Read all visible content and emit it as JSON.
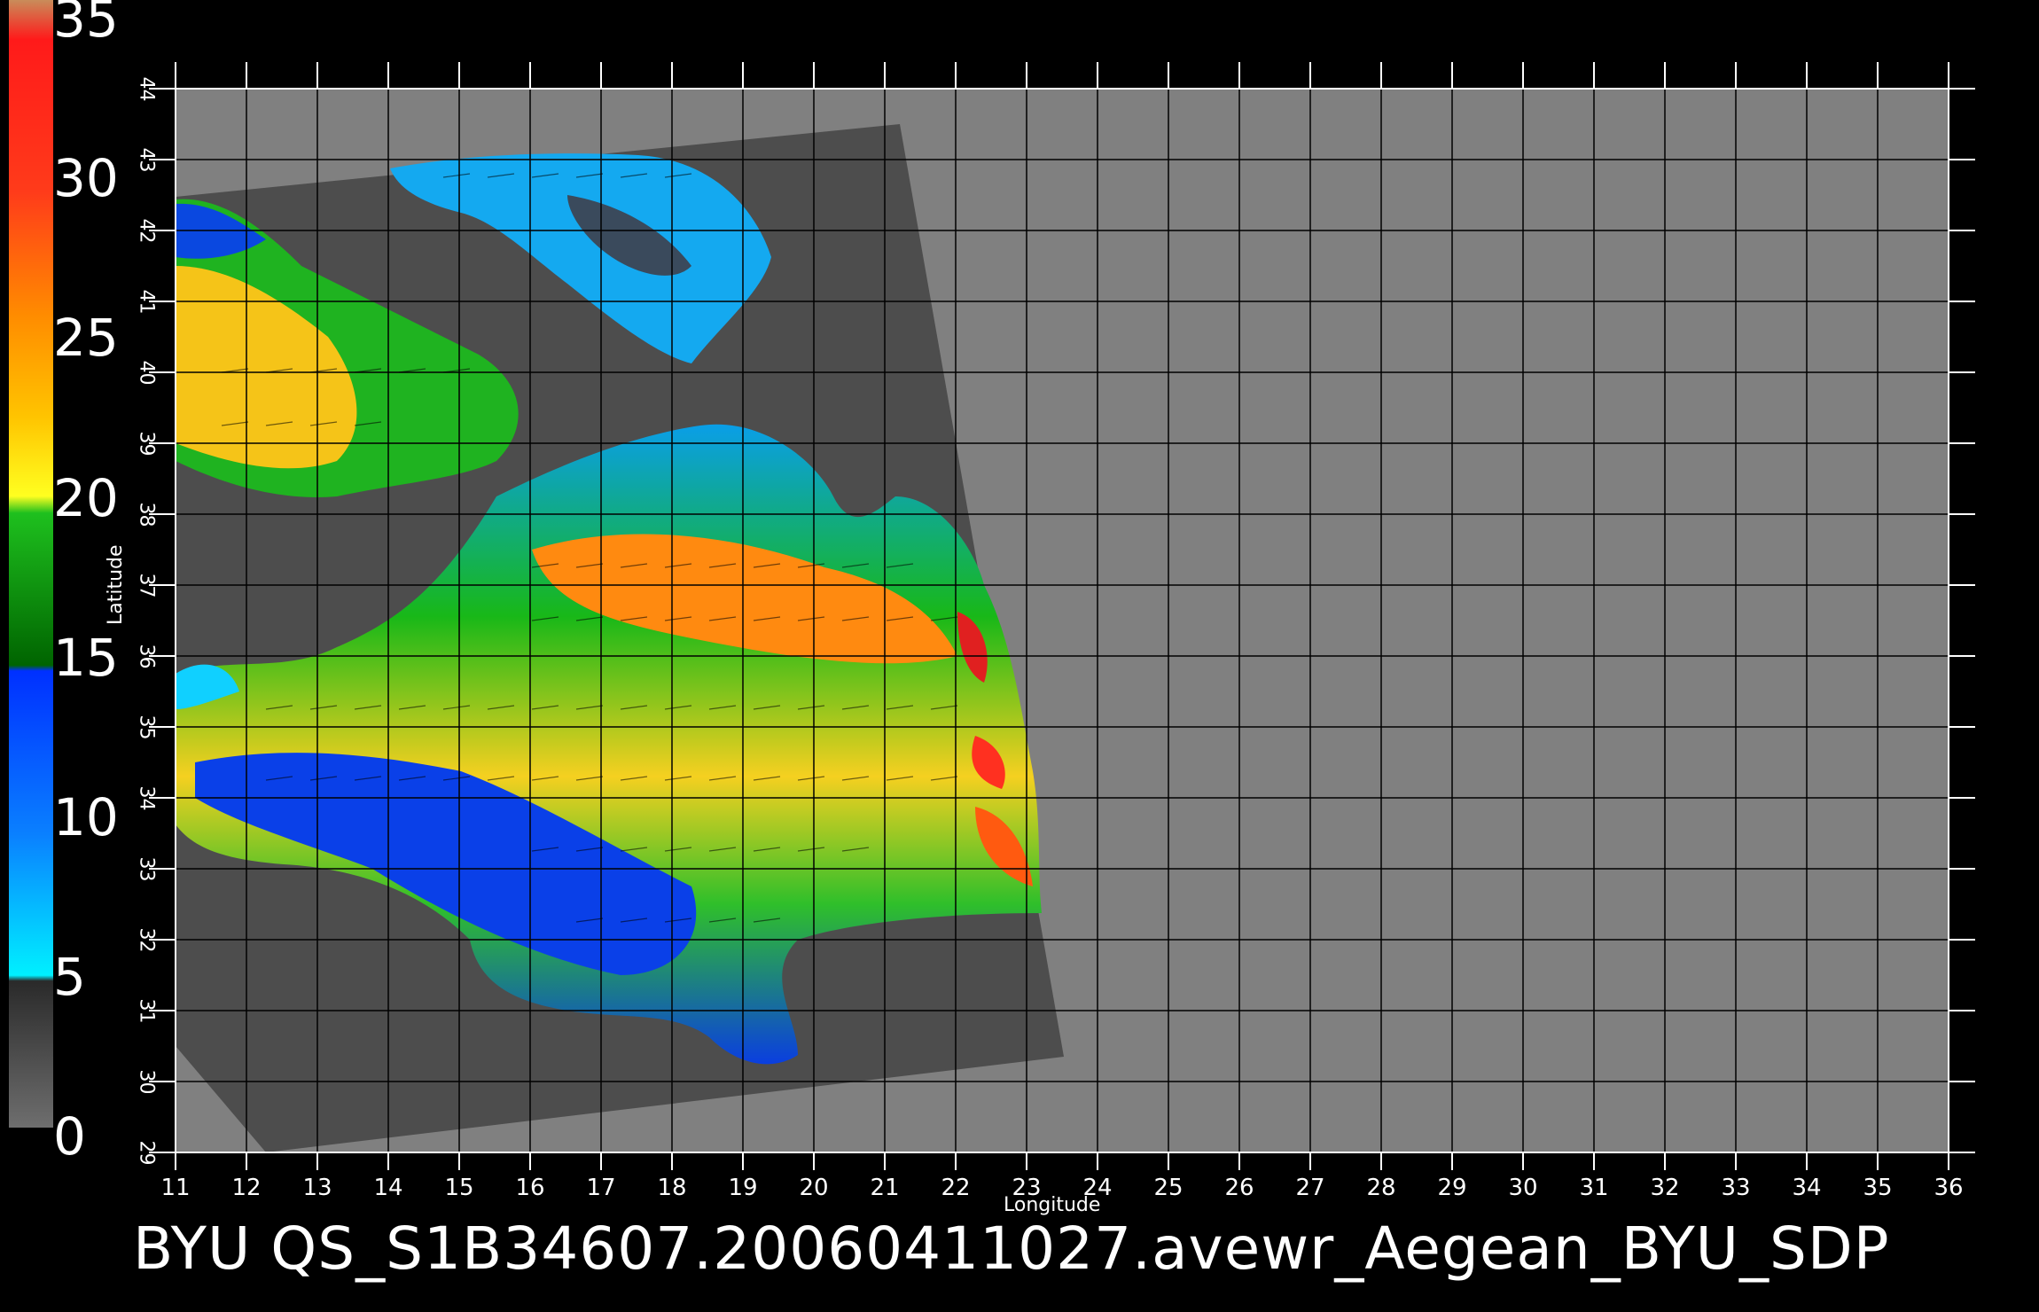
{
  "map": {
    "caption": "BYU  QS_S1B34607.20060411027.avewr_Aegean_BYU_SDP",
    "xlabel": "Longitude",
    "ylabel": "Latitude",
    "lon_range": [
      11,
      36
    ],
    "lat_range": [
      29,
      44
    ],
    "lon_ticks": [
      "11",
      "12",
      "13",
      "14",
      "15",
      "16",
      "17",
      "18",
      "19",
      "20",
      "21",
      "22",
      "23",
      "24",
      "25",
      "26",
      "27",
      "28",
      "29",
      "30",
      "31",
      "32",
      "33",
      "34",
      "35",
      "36"
    ],
    "lat_ticks": [
      "29",
      "30",
      "31",
      "32",
      "33",
      "34",
      "35",
      "36",
      "37",
      "38",
      "39",
      "40",
      "41",
      "42",
      "43",
      "44"
    ]
  },
  "colorbar": {
    "labels": [
      "35",
      "30",
      "25",
      "20",
      "15",
      "10",
      "5",
      "0"
    ],
    "colors": {
      "top": "#c98c5a",
      "red": "#ff2020",
      "orange": "#ff8c00",
      "yellow": "#ffee00",
      "green": "#10a010",
      "darkgreen": "#006400",
      "blue": "#0040ff",
      "cyan": "#00e8ff",
      "gray": "#555555"
    }
  },
  "colors": {
    "background": "#000000",
    "outside_swath": "#808080",
    "swath_land": "#4d4d4d",
    "grid": "#000000"
  }
}
